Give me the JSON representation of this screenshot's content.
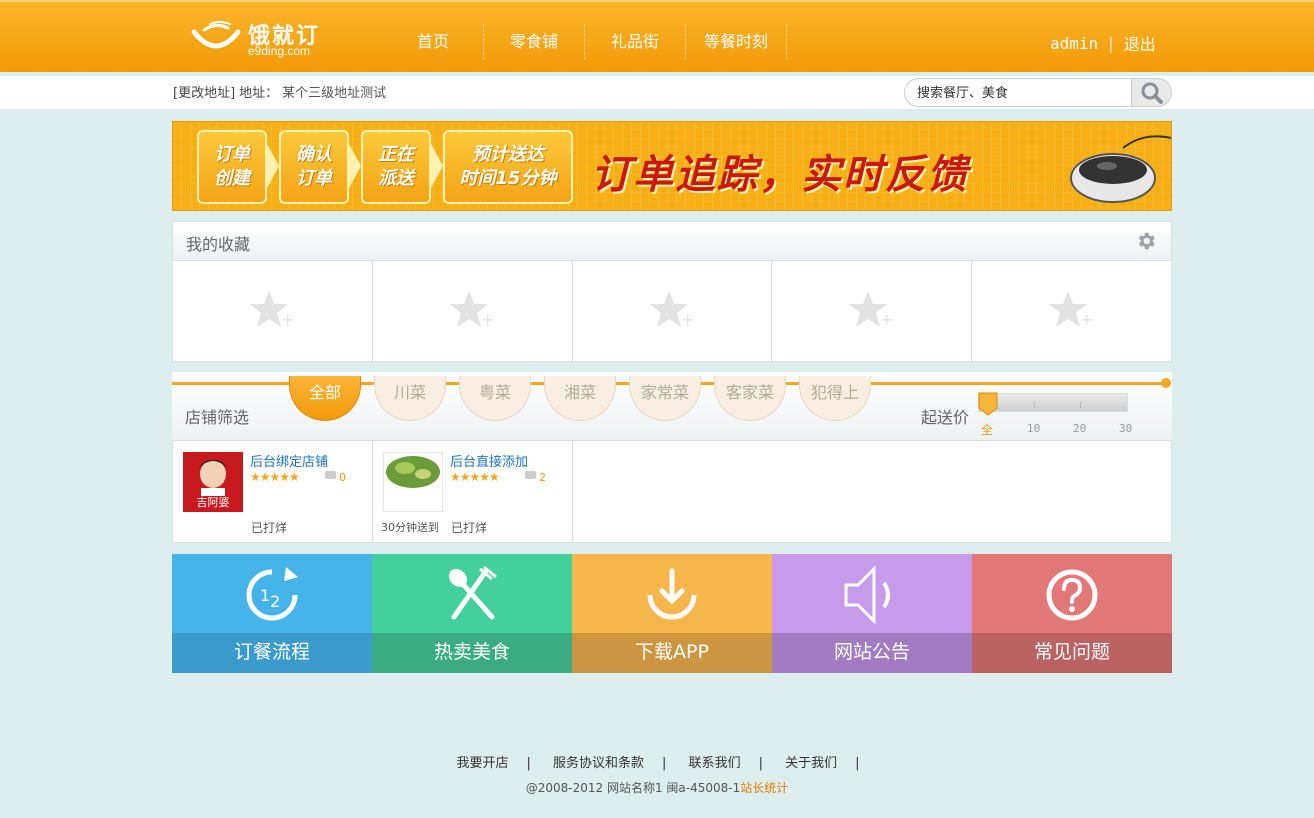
{
  "header": {
    "logo_title": "饿就订",
    "logo_subtitle": "e9ding.com",
    "nav": [
      {
        "label": "首页"
      },
      {
        "label": "零食铺"
      },
      {
        "label": "礼品街"
      },
      {
        "label": "等餐时刻"
      }
    ],
    "user": "admin",
    "logout": "退出",
    "separator": "|"
  },
  "address": {
    "change_label": "[更改地址]",
    "address_label": "地址：",
    "address_value": "某个三级地址测试"
  },
  "search": {
    "placeholder": "搜索餐厅、美食",
    "icon": "search-icon"
  },
  "banner": {
    "steps": [
      {
        "line1": "订单",
        "line2": "创建"
      },
      {
        "line1": "确认",
        "line2": "订单"
      },
      {
        "line1": "正在",
        "line2": "派送"
      },
      {
        "line1": "预计送达",
        "line2": "时间15分钟"
      }
    ],
    "slogan": "订单追踪，实时反馈"
  },
  "favorites": {
    "title": "我的收藏",
    "settings_icon": "gear-icon",
    "slot_icon": "star-plus-icon"
  },
  "filter": {
    "label": "店铺筛选",
    "categories": [
      {
        "label": "全部",
        "active": true
      },
      {
        "label": "川菜",
        "active": false
      },
      {
        "label": "粤菜",
        "active": false
      },
      {
        "label": "湘菜",
        "active": false
      },
      {
        "label": "家常菜",
        "active": false
      },
      {
        "label": "客家菜",
        "active": false
      },
      {
        "label": "犯得上",
        "active": false
      }
    ],
    "price_label": "起送价",
    "price_scale": [
      "全",
      "10",
      "20",
      "30"
    ],
    "price_selected": "全"
  },
  "stores": [
    {
      "name": "后台绑定店铺",
      "rating": 5,
      "stars": "★★★★★",
      "comments": "0",
      "status": "已打烊",
      "delivery": ""
    },
    {
      "name": "后台直接添加",
      "rating": 5,
      "stars": "★★★★★",
      "comments": "2",
      "status": "已打烊",
      "delivery": "30分钟送到"
    }
  ],
  "tiles": [
    {
      "label": "订餐流程",
      "icon": "order-process-icon",
      "color": "#45b4e9",
      "band": "#3a9acb"
    },
    {
      "label": "热卖美食",
      "icon": "fork-spoon-icon",
      "color": "#44d09d",
      "band": "#3aab82"
    },
    {
      "label": "下载APP",
      "icon": "download-icon",
      "color": "#f6b64c",
      "band": "#cb9541"
    },
    {
      "label": "网站公告",
      "icon": "speaker-icon",
      "color": "#c79be9",
      "band": "#a27cc2"
    },
    {
      "label": "常见问题",
      "icon": "question-icon",
      "color": "#e27878",
      "band": "#bb6262"
    }
  ],
  "footer": {
    "links": [
      "我要开店",
      "服务协议和条款",
      "联系我们",
      "关于我们"
    ],
    "copyright": "@2008-2012 网站名称1 闽a-45008-1",
    "stat_link": "站长统计"
  },
  "colors": {
    "brand_orange": "#f5a623",
    "link_blue": "#1a73c5"
  }
}
